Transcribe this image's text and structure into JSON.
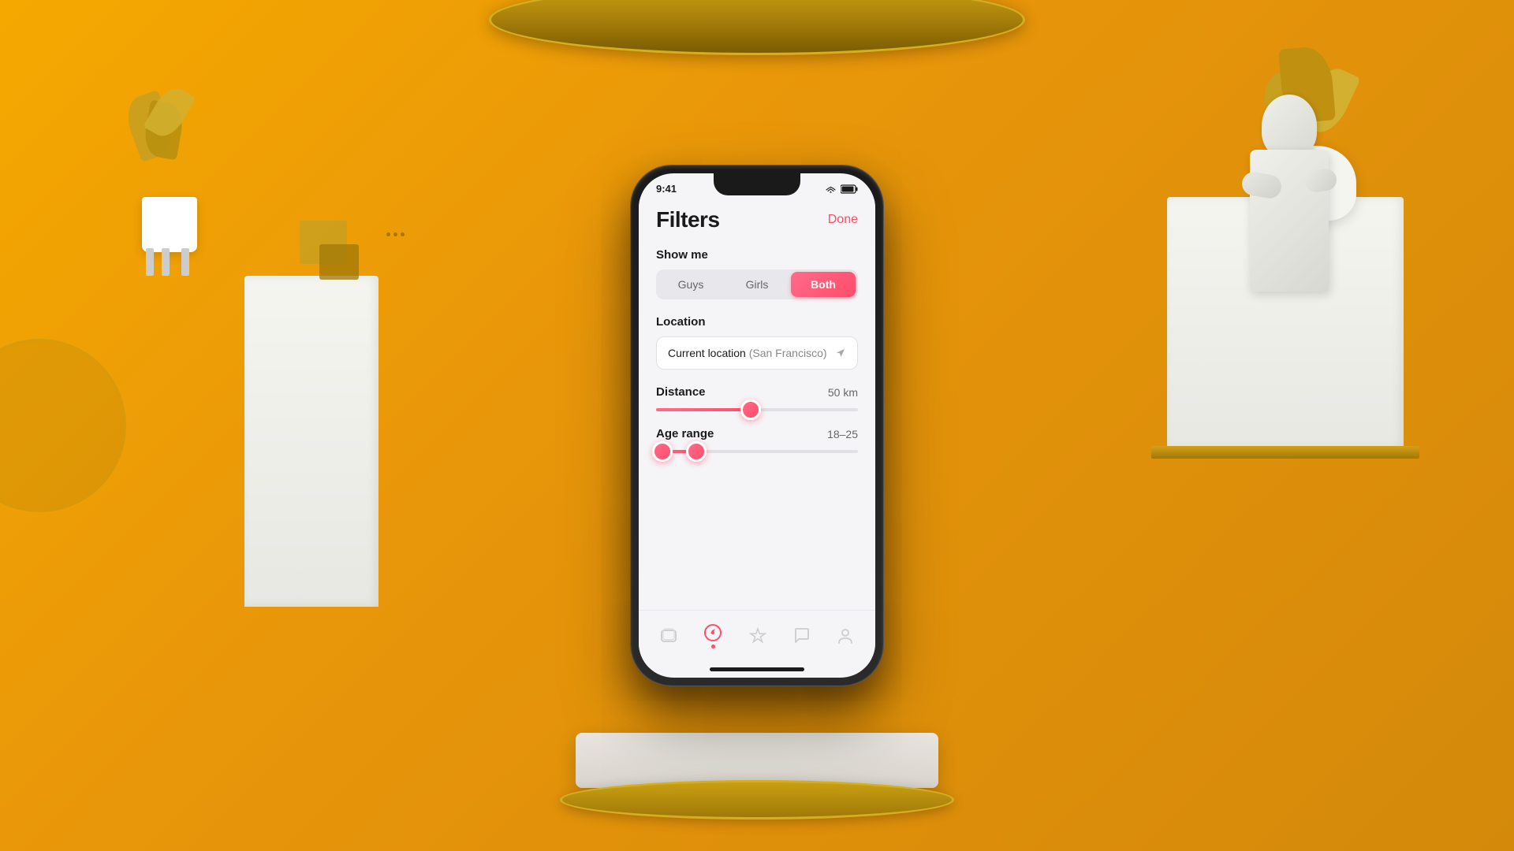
{
  "background": {
    "color": "#F5A800"
  },
  "phone": {
    "status_bar": {
      "time": "9:41",
      "wifi": "wifi",
      "battery": "battery"
    },
    "header": {
      "title": "Filters",
      "done_button": "Done"
    },
    "show_me": {
      "label": "Show me",
      "options": [
        {
          "id": "guys",
          "label": "Guys",
          "active": false
        },
        {
          "id": "girls",
          "label": "Girls",
          "active": false
        },
        {
          "id": "both",
          "label": "Both",
          "active": true
        }
      ]
    },
    "location": {
      "label": "Location",
      "current": "Current location",
      "city": "(San Francisco)"
    },
    "distance": {
      "label": "Distance",
      "value": "50 km",
      "fill_pct": 47
    },
    "age_range": {
      "label": "Age range",
      "value": "18–25",
      "left_pct": 3,
      "right_pct": 20
    },
    "bottom_nav": {
      "items": [
        {
          "id": "cards",
          "icon": "cards",
          "active": false
        },
        {
          "id": "discover",
          "icon": "compass",
          "active": true
        },
        {
          "id": "favorites",
          "icon": "star",
          "active": false
        },
        {
          "id": "chat",
          "icon": "chat",
          "active": false
        },
        {
          "id": "profile",
          "icon": "person",
          "active": false
        }
      ]
    }
  }
}
